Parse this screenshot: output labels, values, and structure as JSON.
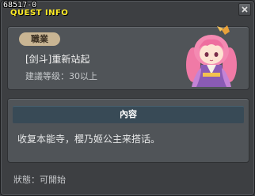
{
  "window": {
    "quest_id": "68517-0",
    "title": "QUEST INFO"
  },
  "quest": {
    "job_label": "職業",
    "name": "[剑斗]重新站起",
    "level_requirement": "建議等级：30以上"
  },
  "content": {
    "header": "內容",
    "text": "收复本能寺，樱乃姬公主来搭话。"
  },
  "status": {
    "text": "狀態：可開始"
  },
  "colors": {
    "title": "#fdeb27",
    "badge": "#c9b593",
    "content_header": "#384a56"
  },
  "icons": {
    "close": "close-icon",
    "npc": "npc-portrait"
  }
}
